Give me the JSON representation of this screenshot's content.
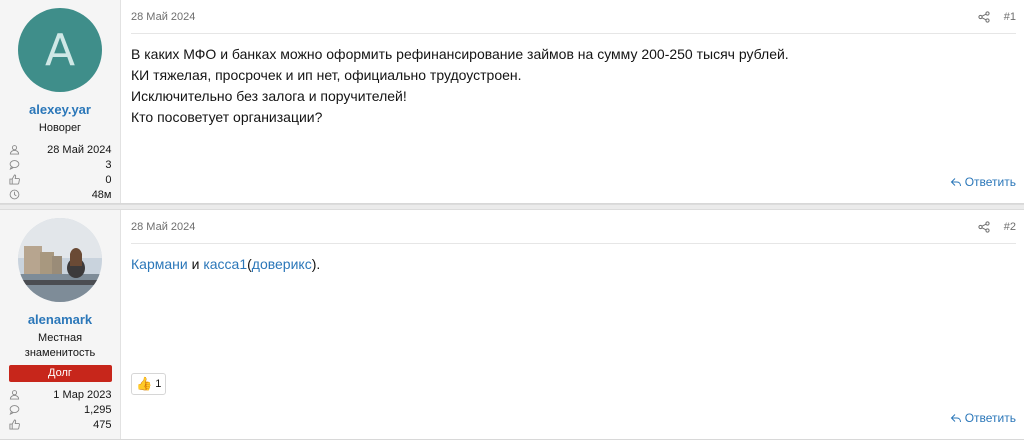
{
  "posts": [
    {
      "author": {
        "name": "alexey.yar",
        "avatar_letter": "A",
        "title": "Новорег",
        "stats": [
          {
            "icon": "user-icon",
            "value": "28 Май 2024"
          },
          {
            "icon": "message-icon",
            "value": "3"
          },
          {
            "icon": "like-icon",
            "value": "0"
          },
          {
            "icon": "clock-icon",
            "value": "48м"
          }
        ]
      },
      "date": "28 Май 2024",
      "number": "#1",
      "lines": [
        "В каких МФО и банках можно оформить рефинансирование займов на сумму 200-250 тысяч рублей.",
        "КИ тяжелая, просрочек и ип нет, официально трудоустроен.",
        "Исключительно без залога и поручителей!",
        "Кто посоветует организации?"
      ],
      "reply_label": "Ответить"
    },
    {
      "author": {
        "name": "alenamark",
        "title_line1": "Местная",
        "title_line2": "знаменитость",
        "badge": "Долг",
        "badge_color": "#c7261b",
        "stats": [
          {
            "icon": "user-icon",
            "value": "1 Мар 2023"
          },
          {
            "icon": "message-icon",
            "value": "1,295"
          },
          {
            "icon": "like-icon",
            "value": "475"
          }
        ]
      },
      "date": "28 Май 2024",
      "number": "#2",
      "body": {
        "link1": "Кармани",
        "and": " и ",
        "link2": "касса1",
        "open": "(",
        "link3": "доверикс",
        "close": ")."
      },
      "reaction_count": "1",
      "reply_label": "Ответить"
    }
  ],
  "colors": {
    "link": "#2b77b9",
    "avatar_bg": "#3f8e8a"
  }
}
